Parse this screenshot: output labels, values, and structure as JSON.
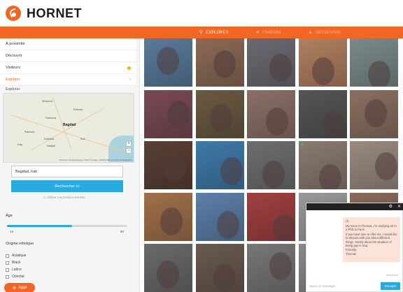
{
  "brand": "HORNET",
  "colors": {
    "accent": "#f26522",
    "primary_button": "#29abe2",
    "online": "#3ec43e"
  },
  "nav": {
    "items": [
      {
        "label": "Explorer",
        "icon": "location-pin-icon"
      },
      {
        "label": "Fandom",
        "icon": "star-icon"
      },
      {
        "label": "Découvrir",
        "icon": "discover-icon"
      }
    ]
  },
  "sidebar": {
    "items": [
      {
        "label": "À proximité"
      },
      {
        "label": "Découvrir"
      },
      {
        "label": "Visiteurs"
      },
      {
        "label": "Explorer"
      }
    ],
    "section_explorer": "Explorer",
    "map": {
      "city": "Bagdad",
      "labels": [
        "Mossoul",
        "Kirkouk",
        "Samarra",
        "Ramadi",
        "Karbala",
        "Nadjaf",
        "Kut",
        "Iraq"
      ],
      "zoom_in": "+",
      "zoom_out": "−",
      "credit": "Données cartographiques ©2017 Google, ORION-ME | Conditions d'utilisation"
    },
    "location_value": "Bagdad, Irak",
    "search_button": "Rechercher ici",
    "use_position": "⊙ Utiliser ma position actuelle",
    "age_label": "Âge",
    "age_min": "18",
    "age_max": "80",
    "ethnicity_label": "Origine ethnique",
    "ethnicity_options": [
      "Asiatique",
      "Black",
      "Latino",
      "Oriental"
    ],
    "apply_button": "Appl"
  },
  "grid": {
    "tiles": [
      {
        "color": "#5a7a9a",
        "online": false
      },
      {
        "color": "#8a6a55",
        "online": false
      },
      {
        "color": "#6a6a72",
        "online": false
      },
      {
        "color": "#b08060",
        "online": false
      },
      {
        "color": "#7a8a8a",
        "online": false
      },
      {
        "color": "#7a4a55",
        "online": false
      },
      {
        "color": "#6a5a40",
        "online": false
      },
      {
        "color": "#8a7065",
        "online": false
      },
      {
        "color": "#555555",
        "online": false
      },
      {
        "color": "#8a7060",
        "online": false
      },
      {
        "color": "#5a4035",
        "online": false
      },
      {
        "color": "#3f7aa8",
        "online": false
      },
      {
        "color": "#6e6e6e",
        "online": false
      },
      {
        "color": "#8a7a70",
        "online": true
      },
      {
        "color": "#9a8a80",
        "online": false
      },
      {
        "color": "#a0704a",
        "online": false
      },
      {
        "color": "#5d7fa8",
        "online": false
      },
      {
        "color": "#a04040",
        "online": false
      },
      {
        "color": "#9a9a9a",
        "online": false
      },
      {
        "color": "#8a6a5a",
        "online": false
      },
      {
        "color": "#6a6a6a",
        "online": false
      },
      {
        "color": "#6a5a50",
        "online": false
      },
      {
        "color": "#777777",
        "online": false
      },
      {
        "color": "#8a8a8a",
        "online": false
      },
      {
        "color": "#555555",
        "online": false
      }
    ]
  },
  "chat": {
    "message": "Hi,\nMy name is Thomas, I'm studying art in a PhD in Paris.\nIf you have time to offer me, I would like to discuss with you about different things. Mostly about the situation of being gay in Iraq.\nFriendly,\nThomas",
    "timestamp": "Maintenant",
    "input_placeholder": "Saisir un message...",
    "send_button": "Envoyer",
    "settings_icon": "gear-icon",
    "close_icon": "close-icon"
  }
}
